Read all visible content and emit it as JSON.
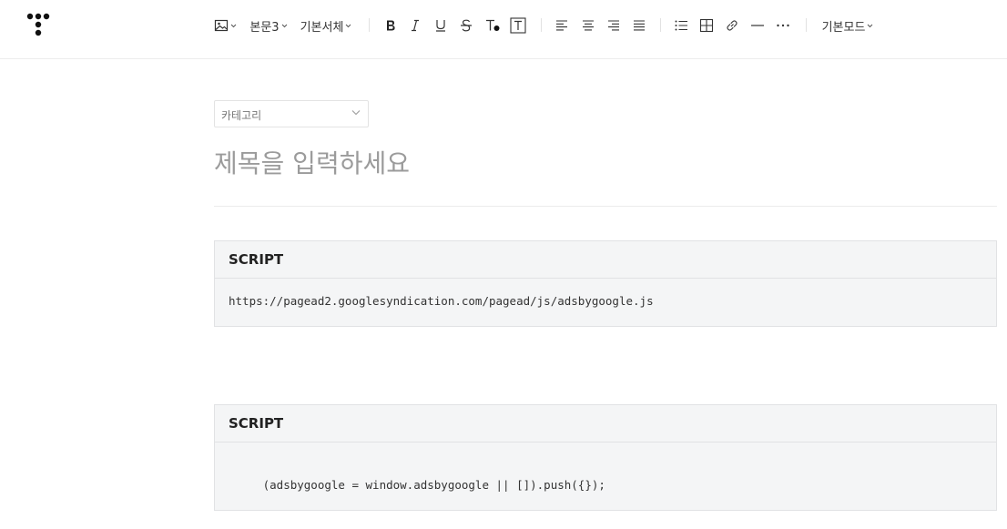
{
  "toolbar": {
    "paragraph_style": "본문3",
    "font_family": "기본서체",
    "mode": "기본모드"
  },
  "editor": {
    "category_placeholder": "카테고리",
    "title_placeholder": "제목을 입력하세요"
  },
  "script_blocks": [
    {
      "header": "SCRIPT",
      "code": "https://pagead2.googlesyndication.com/pagead/js/adsbygoogle.js"
    },
    {
      "header": "SCRIPT",
      "code": "     (adsbygoogle = window.adsbygoogle || []).push({});"
    }
  ]
}
